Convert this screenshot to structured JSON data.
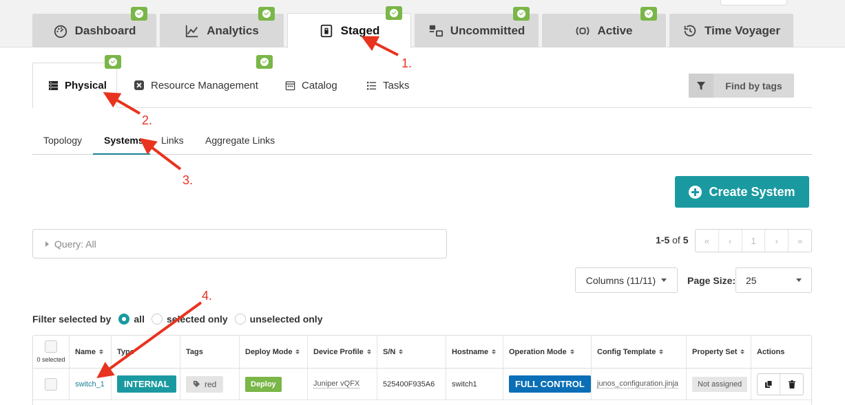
{
  "top_tabs": [
    {
      "label": "Dashboard",
      "icon": "dashboard-icon"
    },
    {
      "label": "Analytics",
      "icon": "analytics-icon"
    },
    {
      "label": "Staged",
      "icon": "staged-icon",
      "active": true
    },
    {
      "label": "Uncommitted",
      "icon": "uncommitted-icon"
    },
    {
      "label": "Active",
      "icon": "active-icon"
    },
    {
      "label": "Time Voyager",
      "icon": "time-voyager-icon"
    }
  ],
  "second_tabs": [
    {
      "label": "Physical",
      "icon": "physical-icon",
      "active": true
    },
    {
      "label": "Resource Management",
      "icon": "resource-management-icon"
    },
    {
      "label": "Catalog",
      "icon": "catalog-icon"
    },
    {
      "label": "Tasks",
      "icon": "tasks-icon"
    }
  ],
  "find_by_tags": "Find by tags",
  "sub_tabs": [
    {
      "label": "Topology"
    },
    {
      "label": "Systems",
      "active": true
    },
    {
      "label": "Links"
    },
    {
      "label": "Aggregate Links"
    }
  ],
  "create_system": "Create System",
  "query": "Query: All",
  "pager": {
    "range": "1-5",
    "of": "of",
    "total": "5",
    "first": "«",
    "prev": "‹",
    "page": "1",
    "next": "›",
    "last": "»"
  },
  "columns_btn": "Columns (11/11)",
  "page_size_label": "Page Size:",
  "page_size_value": "25",
  "filter": {
    "label": "Filter selected by",
    "options": [
      "all",
      "selected only",
      "unselected only"
    ],
    "selected": "all"
  },
  "table": {
    "selected_count": "0 selected",
    "headers": [
      "Name",
      "Type",
      "Tags",
      "Deploy Mode",
      "Device Profile",
      "S/N",
      "Hostname",
      "Operation Mode",
      "Config Template",
      "Property Set",
      "Actions"
    ],
    "rows": [
      {
        "name": "switch_1",
        "type": "INTERNAL",
        "tag": "red",
        "deploy_mode": "Deploy",
        "device_profile": "Juniper vQFX",
        "sn": "525400F935A6",
        "hostname": "switch1",
        "operation_mode": "FULL CONTROL",
        "config_template": "junos_configuration.jinja",
        "property_set": "Not assigned"
      }
    ]
  },
  "annotations": [
    "1.",
    "2.",
    "3.",
    "4."
  ],
  "colors": {
    "teal": "#1a9aa0",
    "green": "#7ab648",
    "blue": "#0a6fb6",
    "annotation": "#e8331f"
  }
}
